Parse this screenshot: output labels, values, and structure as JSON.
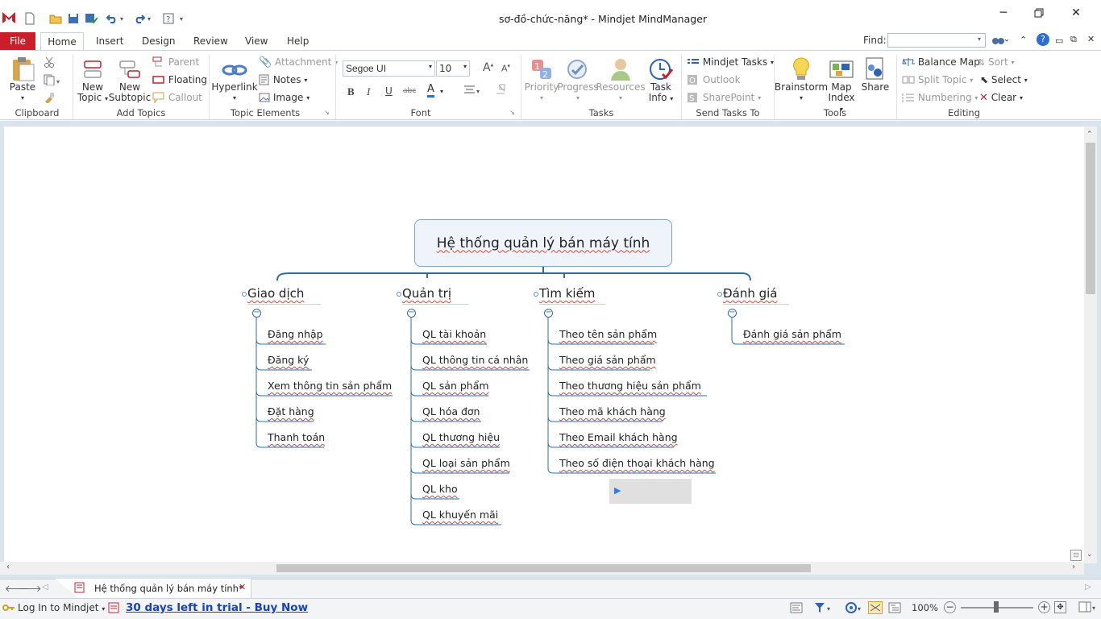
{
  "window": {
    "title": "sơ-đồ-chức-năng* - Mindjet MindManager"
  },
  "menu": {
    "file": "File",
    "tabs": [
      "Home",
      "Insert",
      "Design",
      "Review",
      "View",
      "Help"
    ]
  },
  "find": {
    "label": "Find:",
    "value": ""
  },
  "ribbon": {
    "clipboard": {
      "label": "Clipboard",
      "paste": "Paste"
    },
    "add_topics": {
      "label": "Add Topics",
      "new_topic": "New",
      "new_topic2": "Topic",
      "new_subtopic": "New",
      "new_subtopic2": "Subtopic",
      "parent": "Parent",
      "floating": "Floating",
      "callout": "Callout"
    },
    "topic_elements": {
      "label": "Topic Elements",
      "hyperlink": "Hyperlink",
      "attachment": "Attachment",
      "notes": "Notes",
      "image": "Image"
    },
    "font": {
      "label": "Font",
      "family": "Segoe UI",
      "size": "10"
    },
    "tasks": {
      "label": "Tasks",
      "priority": "Priority",
      "progress": "Progress",
      "resources": "Resources",
      "task_info": "Task",
      "task_info2": "Info"
    },
    "send_tasks": {
      "label": "Send Tasks To",
      "mindjet_tasks": "Mindjet Tasks",
      "outlook": "Outlook",
      "sharepoint": "SharePoint"
    },
    "tools": {
      "label": "Tools",
      "brainstorm": "Brainstorm",
      "map_index": "Map",
      "map_index2": "Index",
      "share": "Share"
    },
    "editing": {
      "label": "Editing",
      "balance_map": "Balance Map",
      "sort": "Sort",
      "split_topic": "Split Topic",
      "select": "Select",
      "numbering": "Numbering",
      "clear": "Clear"
    }
  },
  "map": {
    "central": "Hệ thống quản lý bán máy tính",
    "branches": [
      {
        "title": "Giao dịch",
        "items": [
          "Đăng nhập",
          "Đăng ký",
          "Xem thông tin sản phẩm",
          "Đặt hàng",
          "Thanh toán"
        ]
      },
      {
        "title": "Quản trị",
        "items": [
          "QL tài khoản",
          "QL thông tin cá nhân",
          "QL sản phẩm",
          "QL hóa đơn",
          "QL thương hiệu",
          "QL loại sản phẩm",
          "QL kho",
          "QL khuyến mãi"
        ]
      },
      {
        "title": "Tìm kiếm",
        "items": [
          "Theo tên sản phẩm",
          "Theo giá sản phẩm",
          "Theo thương hiệu sản phẩm",
          "Theo mã khách hàng",
          "Theo Email khách hàng",
          "Theo số điện thoại khách hàng"
        ]
      },
      {
        "title": "Đánh giá",
        "items": [
          "Đánh giá sản phẩm"
        ]
      }
    ]
  },
  "doc_tab": {
    "label": "Hệ thống quản lý bán máy tính*"
  },
  "status": {
    "login": "Log In to Mindjet",
    "trial": "30 days left in trial - Buy Now",
    "zoom": "100%"
  },
  "colors": {
    "accent": "#2e6da4",
    "file_tab": "#c8202a",
    "trial_link": "#1a3fbf"
  }
}
